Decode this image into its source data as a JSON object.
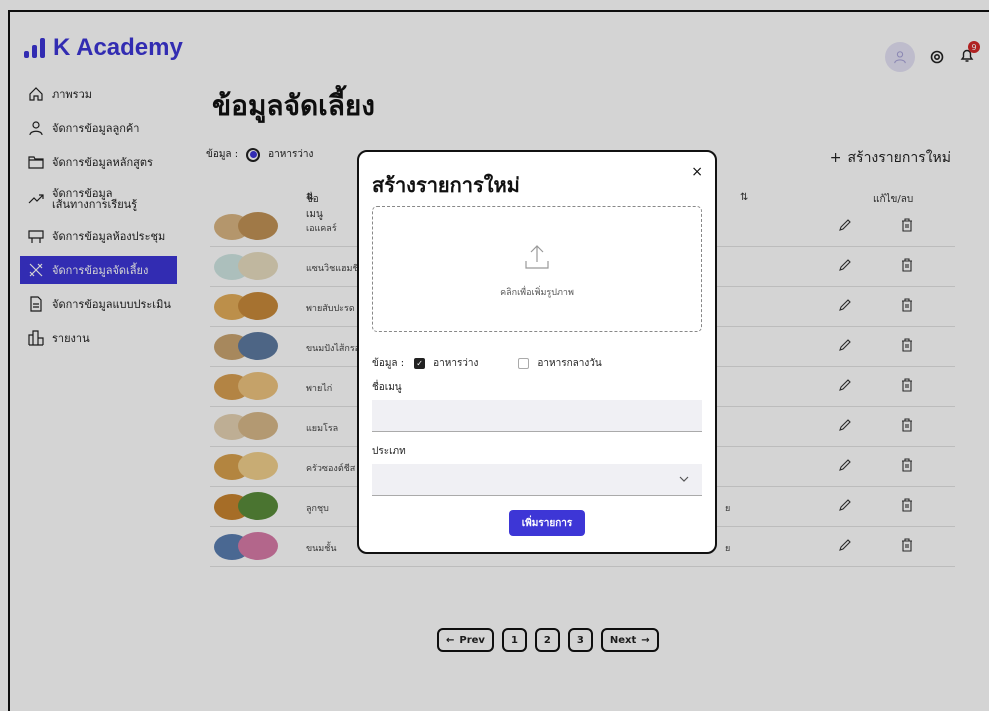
{
  "app": {
    "name": "K Academy"
  },
  "sidebar": {
    "items": [
      {
        "label": "ภาพรวม"
      },
      {
        "label": "จัดการข้อมูลลูกค้า"
      },
      {
        "label": "จัดการข้อมูลหลักสูตร"
      },
      {
        "label_line1": "จัดการข้อมูล",
        "label_line2": "เส้นทางการเรียนรู้"
      },
      {
        "label": "จัดการข้อมูลห้องประชุม"
      },
      {
        "label": "จัดการข้อมูลจัดเลี้ยง"
      },
      {
        "label": "จัดการข้อมูลแบบประเมิน"
      },
      {
        "label": "รายงาน"
      }
    ]
  },
  "header": {
    "notification_count": "9"
  },
  "page": {
    "title": "ข้อมูลจัดเลี้ยง",
    "filter_label": "ข้อมูล :",
    "filter_option": "อาหารว่าง",
    "new_item": "สร้างรายการใหม่"
  },
  "table": {
    "col_menu": "ชื่อเมนู",
    "col_actions": "แก้ไข/ลบ",
    "rows": [
      {
        "name": "เอแคลร์",
        "extra": ""
      },
      {
        "name": "แซนวิชแฮมชีส",
        "extra": ""
      },
      {
        "name": "พายสับปะรด",
        "extra": ""
      },
      {
        "name": "ขนมปังไส้กรอก",
        "extra": ""
      },
      {
        "name": "พายไก่",
        "extra": ""
      },
      {
        "name": "แยมโรล",
        "extra": ""
      },
      {
        "name": "ครัวซองต์ชีส",
        "extra": ""
      },
      {
        "name": "ลูกชุบ",
        "extra": "ย"
      },
      {
        "name": "ขนมชั้น",
        "extra": "ย"
      }
    ]
  },
  "pagination": {
    "prev": "Prev",
    "pages": [
      "1",
      "2",
      "3"
    ],
    "next": "Next"
  },
  "modal": {
    "title": "สร้างรายการใหม่",
    "close": "×",
    "upload_text": "คลิกเพื่อเพิ่มรูปภาพ",
    "filter_label": "ข้อมูล :",
    "option1": "อาหารว่าง",
    "option1_checked": true,
    "option2": "อาหารกลางวัน",
    "option2_checked": false,
    "name_label": "ชื่อเมนู",
    "name_value": "",
    "type_label": "ประเภท",
    "type_value": "",
    "submit": "เพิ่มรายการ"
  },
  "colors": {
    "accent": "#3d36d6",
    "badge": "#d42a2a"
  }
}
